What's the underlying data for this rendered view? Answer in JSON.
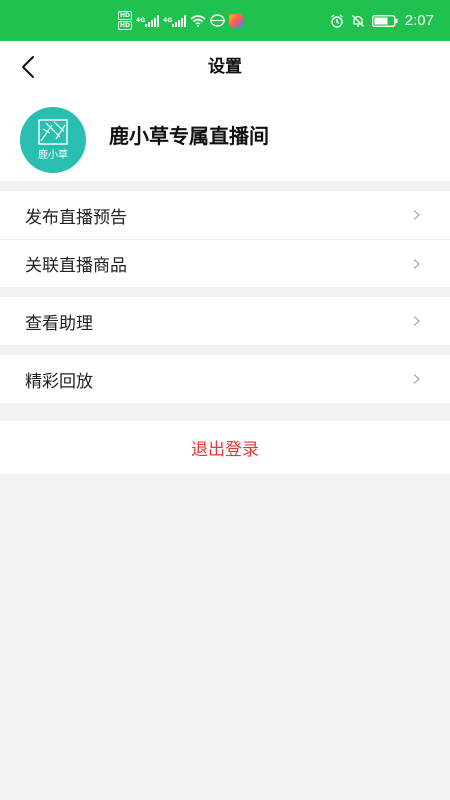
{
  "status_bar": {
    "time": "2:07",
    "hd1": "HD",
    "hd2": "HD",
    "net1": "4G",
    "net2": "4G",
    "colors": {
      "background": "#1fc24f"
    }
  },
  "header": {
    "title": "设置",
    "back_icon": "back-arrow-icon"
  },
  "profile": {
    "avatar_text": "鹿小草",
    "room_name": "鹿小草专属直播间",
    "avatar_color": "#29bfb0"
  },
  "menu": {
    "group1": [
      {
        "label": "发布直播预告"
      },
      {
        "label": "关联直播商品"
      }
    ],
    "group2": [
      {
        "label": "查看助理"
      }
    ],
    "group3": [
      {
        "label": "精彩回放"
      }
    ]
  },
  "logout": {
    "label": "退出登录",
    "color": "#e53935"
  }
}
